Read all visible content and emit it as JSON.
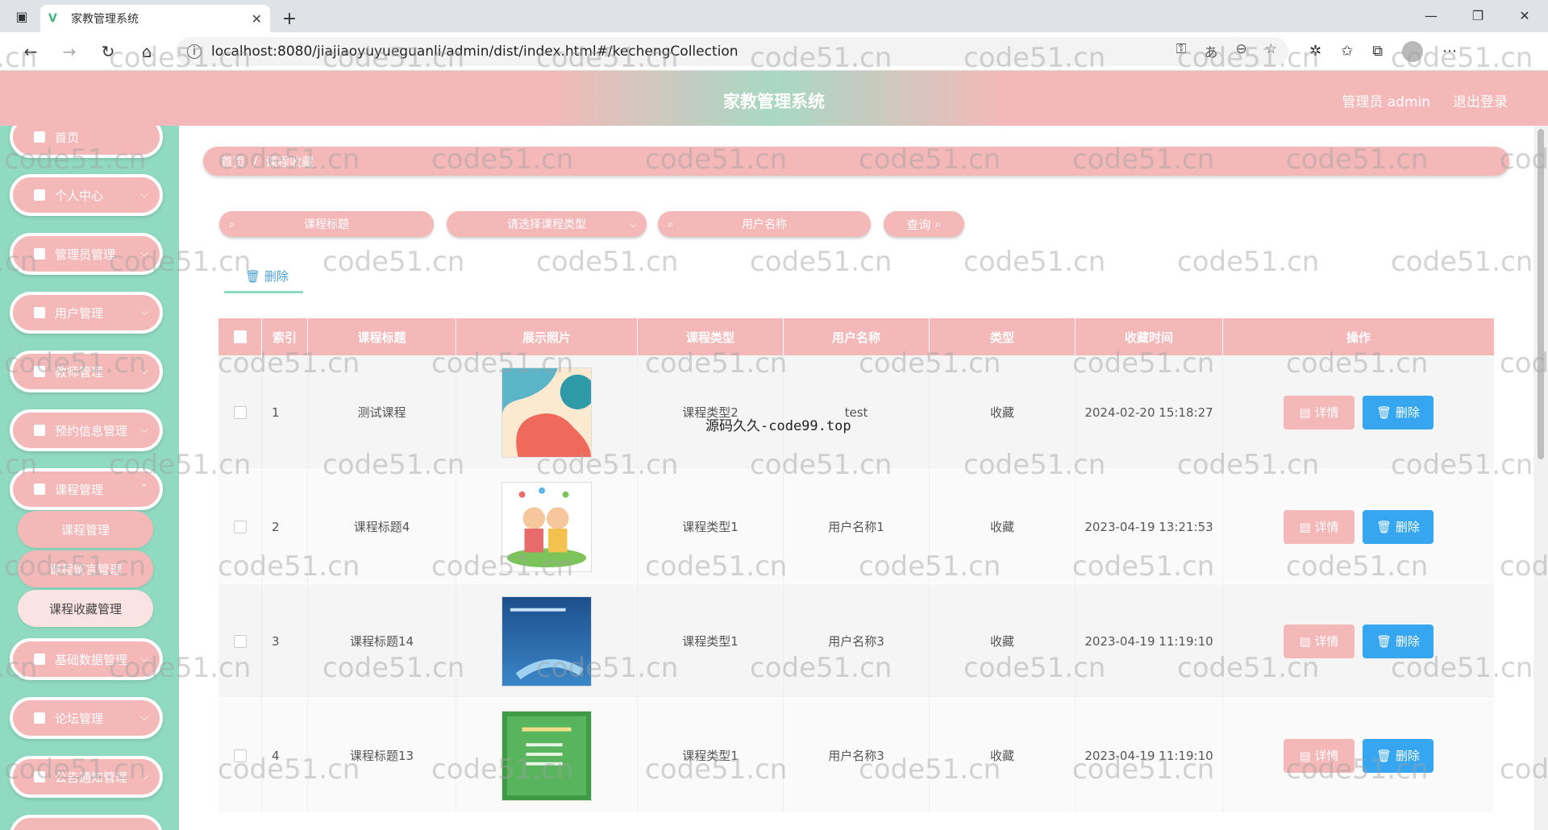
{
  "browser": {
    "tab_title": "家教管理系统",
    "url": "localhost:8080/jiajiaoyuyueguanli/admin/dist/index.html#/kechengCollection"
  },
  "header": {
    "title": "家教管理系统",
    "admin_label": "管理员 admin",
    "logout_label": "退出登录"
  },
  "sidebar": {
    "items": [
      {
        "label": "首页",
        "icon": "home-icon"
      },
      {
        "label": "个人中心",
        "icon": "user-icon"
      },
      {
        "label": "管理员管理",
        "icon": "folder-icon"
      },
      {
        "label": "用户管理",
        "icon": "flag-icon"
      },
      {
        "label": "教师管理",
        "icon": "user-icon"
      },
      {
        "label": "预约信息管理",
        "icon": "grid-icon"
      },
      {
        "label": "课程管理",
        "icon": "book-icon"
      },
      {
        "label": "基础数据管理",
        "icon": "grid-icon"
      },
      {
        "label": "论坛管理",
        "icon": "grid-icon"
      },
      {
        "label": "公告通知管理",
        "icon": "briefcase-icon"
      }
    ],
    "subitems": [
      "课程管理",
      "课程留言管理",
      "课程收藏管理"
    ]
  },
  "breadcrumb": {
    "home": "首页",
    "sep": "/",
    "current": "课程收藏"
  },
  "search": {
    "title_placeholder": "课程标题",
    "type_placeholder": "请选择课程类型",
    "user_placeholder": "用户名称",
    "query_label": "查询"
  },
  "toolbar": {
    "delete_label": "删除"
  },
  "table": {
    "headers": [
      "索引",
      "课程标题",
      "展示照片",
      "课程类型",
      "用户名称",
      "类型",
      "收藏时间",
      "操作"
    ],
    "rows": [
      {
        "index": "1",
        "title": "测试课程",
        "type": "课程类型2",
        "user": "test",
        "kind": "收藏",
        "time": "2024-02-20 15:18:27"
      },
      {
        "index": "2",
        "title": "课程标题4",
        "type": "课程类型1",
        "user": "用户名称1",
        "kind": "收藏",
        "time": "2023-04-19 13:21:53"
      },
      {
        "index": "3",
        "title": "课程标题14",
        "type": "课程类型1",
        "user": "用户名称3",
        "kind": "收藏",
        "time": "2023-04-19 11:19:10"
      },
      {
        "index": "4",
        "title": "课程标题13",
        "type": "课程类型1",
        "user": "用户名称3",
        "kind": "收藏",
        "time": "2023-04-19 11:19:10"
      }
    ],
    "detail_label": "详情",
    "delete_label": "删除"
  },
  "overlay_text": "源码久久-code99.top",
  "watermark": "code51.cn",
  "colors": {
    "pink": "#f4b8b8",
    "mint": "#8fdac0",
    "blue": "#37a6f1"
  }
}
